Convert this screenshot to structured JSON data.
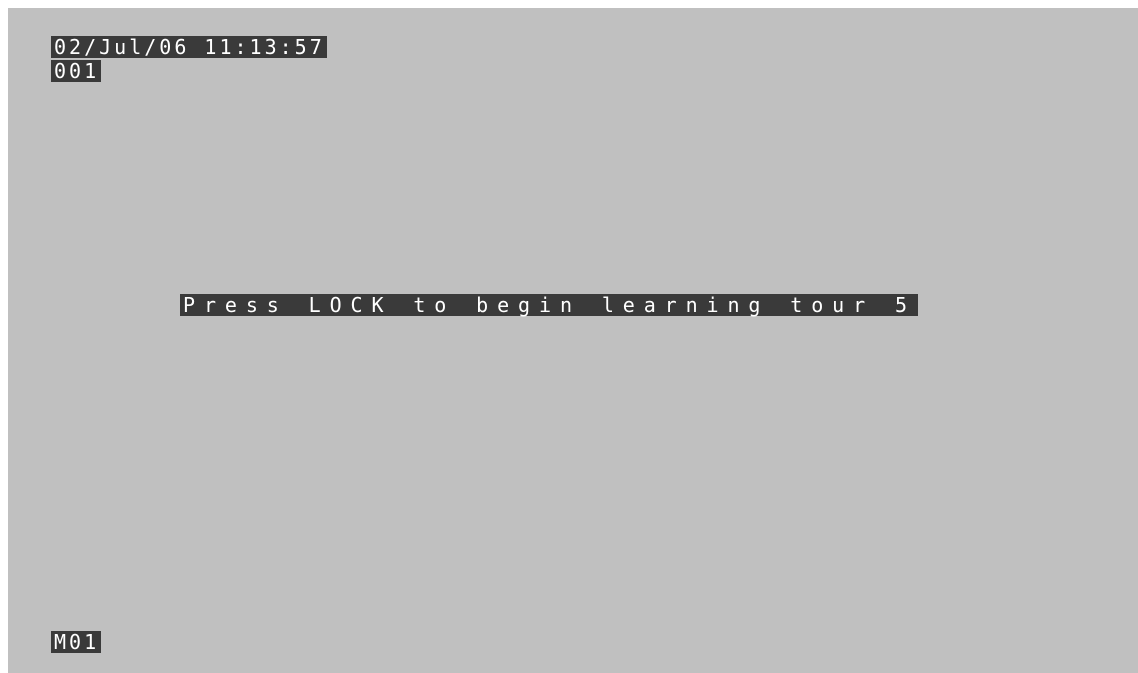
{
  "osd": {
    "datetime": "02/Jul/06 11:13:57",
    "camera_number": "001",
    "message": "Press LOCK to begin learning tour 5",
    "monitor_id": "M01"
  },
  "colors": {
    "background": "#c0c0c0",
    "label_background": "#3a3a3a",
    "label_text": "#ffffff"
  }
}
